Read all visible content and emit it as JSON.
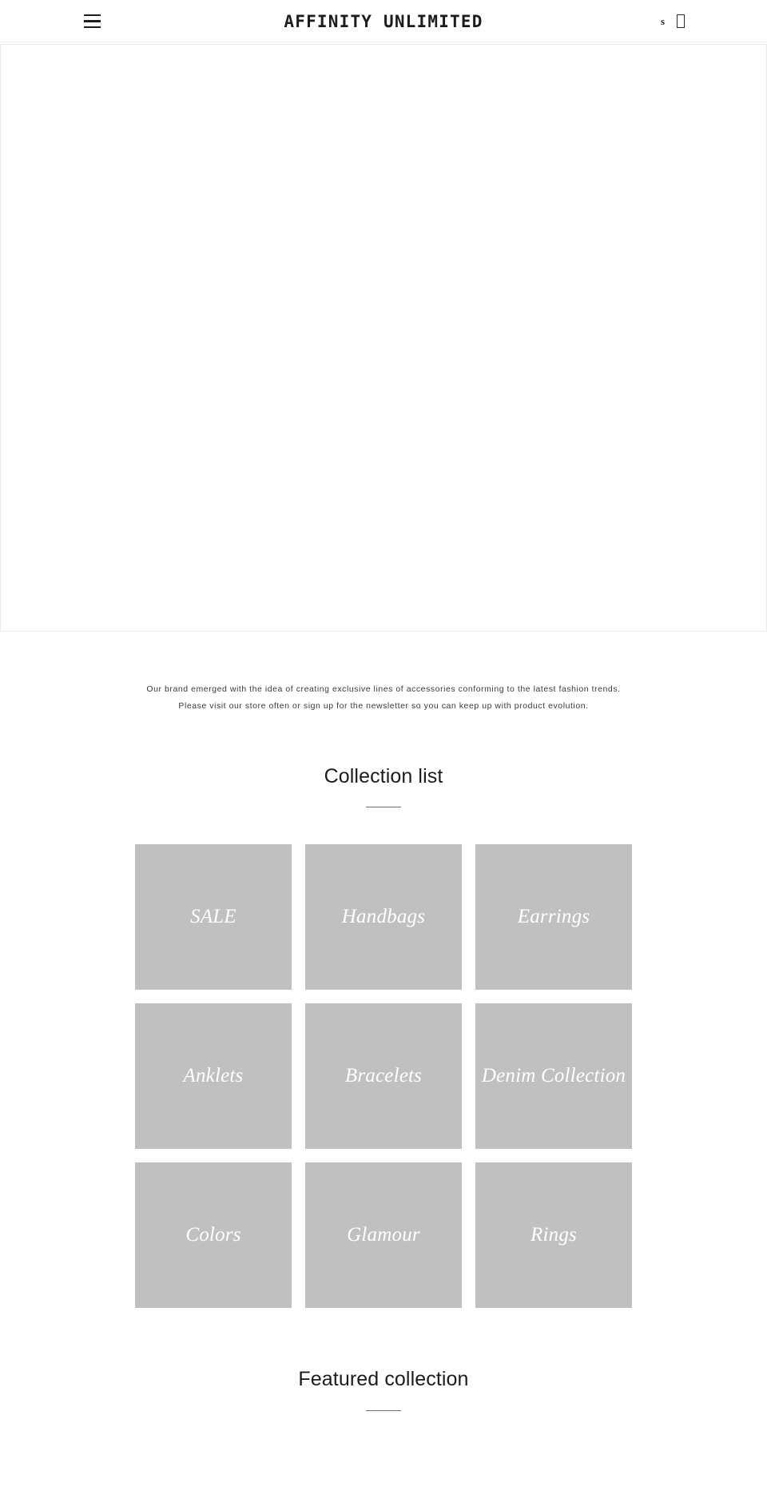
{
  "header": {
    "menu_label": "Menu",
    "site_title": "AFFINITY UNLIMITED",
    "search_label": "s",
    "cart_label": "",
    "icons": {
      "menu": "hamburger-menu-icon",
      "search": "search-icon",
      "cart": "shopping-cart-icon"
    }
  },
  "hero": {
    "alt": ""
  },
  "intro": {
    "text": "Our brand emerged with the idea of creating exclusive lines of accessories conforming to the latest fashion trends.  Please visit our store often or sign up for the newsletter so you can keep up with product evolution."
  },
  "collection_list": {
    "heading": "Collection list",
    "items": [
      {
        "title": "SALE"
      },
      {
        "title": "Handbags"
      },
      {
        "title": "Earrings"
      },
      {
        "title": "Anklets"
      },
      {
        "title": "Bracelets"
      },
      {
        "title": "Denim Collection"
      },
      {
        "title": "Colors"
      },
      {
        "title": "Glamour"
      },
      {
        "title": "Rings"
      }
    ]
  },
  "featured_collection": {
    "heading": "Featured collection"
  },
  "colors": {
    "page_background": "#ffffff",
    "text": "#1c1c1c",
    "muted_text": "#3a3a3a",
    "tile_background": "#c0c0c0",
    "tile_text": "#ffffff",
    "border": "#ececec",
    "rule": "#6f6f6f"
  }
}
